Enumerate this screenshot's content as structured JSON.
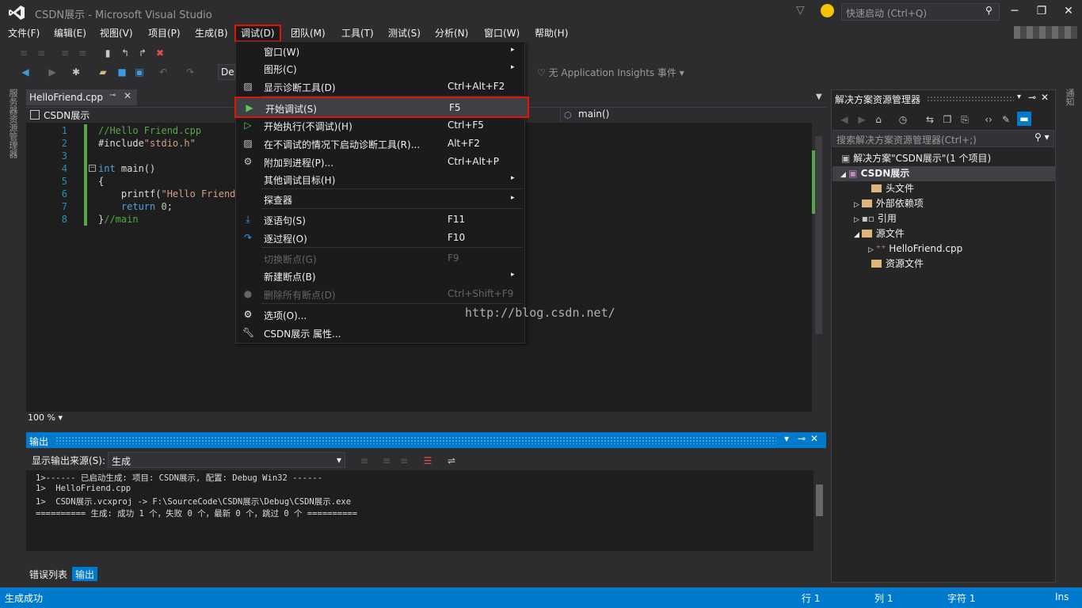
{
  "window": {
    "title": "CSDN展示 - Microsoft Visual Studio",
    "quick_launch_placeholder": "快速启动 (Ctrl+Q)"
  },
  "menubar": [
    "文件(F)",
    "编辑(E)",
    "视图(V)",
    "项目(P)",
    "生成(B)",
    "调试(D)",
    "团队(M)",
    "工具(T)",
    "测试(S)",
    "分析(N)",
    "窗口(W)",
    "帮助(H)"
  ],
  "toolbar": {
    "config_combo": "De",
    "insights_label": "无 Application Insights 事件"
  },
  "left_strip": "服务器资源管理器",
  "right_strip": "通知",
  "editor": {
    "tab": "HelloFriend.cpp",
    "scope": "CSDN展示",
    "member": "main()",
    "zoom": "100 %",
    "line_numbers": [
      "1",
      "2",
      "3",
      "4",
      "5",
      "6",
      "7",
      "8"
    ],
    "code": {
      "l1": "//Hello Friend.cpp",
      "l2_kw": "#include",
      "l2_str": "\"stdio.h\"",
      "l4_kw": "int",
      "l4_rest": " main()",
      "l5": "{",
      "l6_a": "    printf(",
      "l6_str": "\"Hello Friend!",
      "l7_kw": "    return",
      "l7_num": " 0",
      "l7_end": ";",
      "l8_a": "}",
      "l8_comment": "//main"
    }
  },
  "debug_menu": [
    {
      "label": "窗口(W)",
      "key": "",
      "arrow": "▸"
    },
    {
      "label": "图形(C)",
      "key": "",
      "arrow": "▸"
    },
    {
      "label": "显示诊断工具(D)",
      "key": "Ctrl+Alt+F2",
      "arrow": ""
    },
    {
      "label": "开始调试(S)",
      "key": "F5",
      "arrow": ""
    },
    {
      "label": "开始执行(不调试)(H)",
      "key": "Ctrl+F5",
      "arrow": ""
    },
    {
      "label": "在不调试的情况下启动诊断工具(R)...",
      "key": "Alt+F2",
      "arrow": ""
    },
    {
      "label": "附加到进程(P)...",
      "key": "Ctrl+Alt+P",
      "arrow": ""
    },
    {
      "label": "其他调试目标(H)",
      "key": "",
      "arrow": "▸"
    },
    {
      "label": "探查器",
      "key": "",
      "arrow": "▸"
    },
    {
      "label": "逐语句(S)",
      "key": "F11",
      "arrow": ""
    },
    {
      "label": "逐过程(O)",
      "key": "F10",
      "arrow": ""
    },
    {
      "label": "切换断点(G)",
      "key": "F9",
      "arrow": ""
    },
    {
      "label": "新建断点(B)",
      "key": "",
      "arrow": "▸"
    },
    {
      "label": "删除所有断点(D)",
      "key": "Ctrl+Shift+F9",
      "arrow": ""
    },
    {
      "label": "选项(O)...",
      "key": "",
      "arrow": ""
    },
    {
      "label": "CSDN展示 属性...",
      "key": "",
      "arrow": ""
    }
  ],
  "watermark": "http://blog.csdn.net/",
  "output": {
    "title": "输出",
    "source_label": "显示输出来源(S):",
    "source_value": "生成",
    "lines": [
      "1>------ 已启动生成: 项目: CSDN展示, 配置: Debug Win32 ------",
      "1>  HelloFriend.cpp",
      "1>  CSDN展示.vcxproj -> F:\\SourceCode\\CSDN展示\\Debug\\CSDN展示.exe",
      "========== 生成: 成功 1 个，失败 0 个，最新 0 个，跳过 0 个 =========="
    ]
  },
  "bottom_tabs": [
    "错误列表",
    "输出"
  ],
  "solution_explorer": {
    "title": "解决方案资源管理器",
    "search_placeholder": "搜索解决方案资源管理器(Ctrl+;)",
    "solution": "解决方案\"CSDN展示\"(1 个项目)",
    "project": "CSDN展示",
    "items": [
      "头文件",
      "外部依赖项",
      "引用",
      "源文件",
      "HelloFriend.cpp",
      "资源文件"
    ]
  },
  "statusbar": {
    "message": "生成成功",
    "line": "行 1",
    "col": "列 1",
    "char": "字符 1",
    "mode": "Ins"
  },
  "colors": {
    "accent": "#007acc",
    "highlight_border": "#e51400",
    "background": "#2d2d30"
  }
}
